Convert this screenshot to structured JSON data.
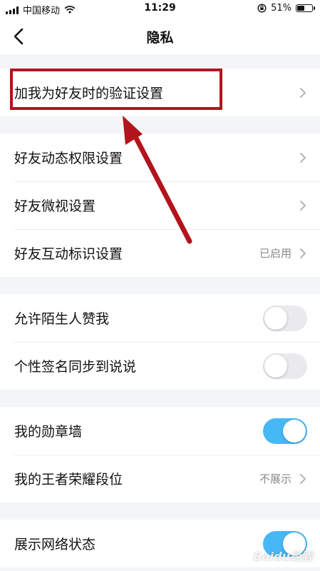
{
  "status_bar": {
    "carrier": "中国移动",
    "time": "11:29",
    "battery": "51%",
    "battery_level": 0.51
  },
  "nav": {
    "title": "隐私",
    "back_icon": "chevron-left-icon"
  },
  "groups": [
    {
      "rows": [
        {
          "label": "加我为好友时的验证设置",
          "control": "chevron"
        }
      ]
    },
    {
      "rows": [
        {
          "label": "好友动态权限设置",
          "control": "chevron"
        },
        {
          "label": "好友微视设置",
          "control": "chevron"
        },
        {
          "label": "好友互动标识设置",
          "value": "已启用",
          "control": "chevron"
        }
      ]
    },
    {
      "rows": [
        {
          "label": "允许陌生人赞我",
          "control": "toggle",
          "on": false
        },
        {
          "label": "个性签名同步到说说",
          "control": "toggle",
          "on": false
        }
      ]
    },
    {
      "rows": [
        {
          "label": "我的勋章墙",
          "control": "toggle",
          "on": true
        },
        {
          "label": "我的王者荣耀段位",
          "value": "不展示",
          "control": "chevron"
        }
      ]
    },
    {
      "rows": [
        {
          "label": "展示网络状态",
          "control": "toggle",
          "on": true
        }
      ]
    }
  ],
  "colors": {
    "toggle_on": "#45b8f5",
    "toggle_off": "#e9e9ee",
    "annotation": "#b3141c"
  },
  "watermark": "Baidu经验"
}
